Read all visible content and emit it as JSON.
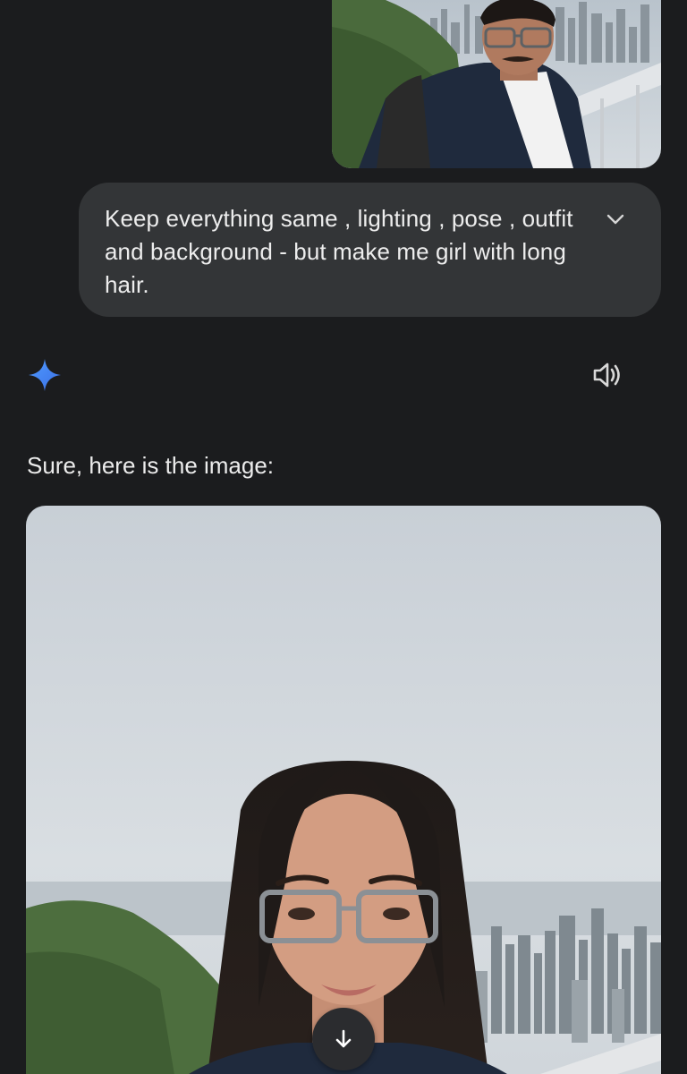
{
  "conversation": {
    "user_message": {
      "text": "Keep everything same , lighting , pose , outfit and background - but make me girl with long hair.",
      "expand_icon": "chevron-down-icon"
    },
    "assistant": {
      "avatar_icon": "gemini-spark-icon",
      "speaker_icon": "speaker-icon",
      "response_text": "Sure, here is the image:"
    },
    "scroll_icon": "arrow-down-icon"
  },
  "colors": {
    "background": "#1b1c1e",
    "bubble": "#333537",
    "spark_blue": "#4a8df8"
  }
}
